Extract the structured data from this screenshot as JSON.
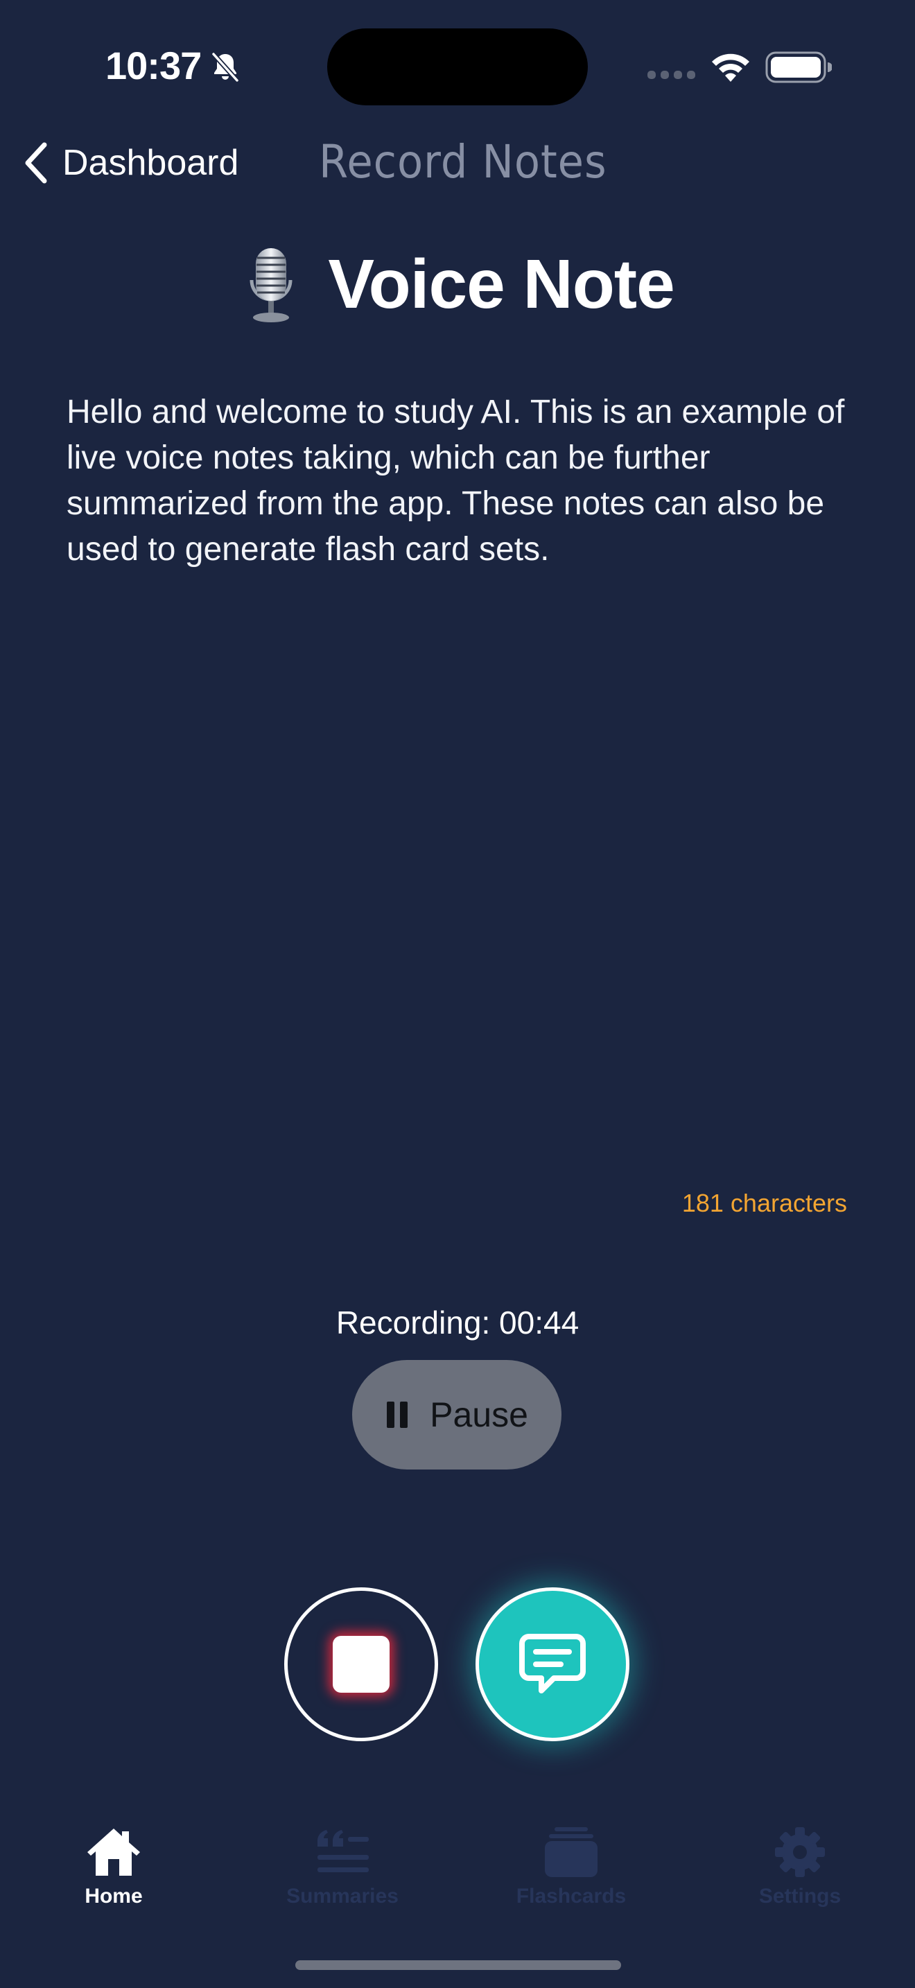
{
  "status_bar": {
    "time": "10:37"
  },
  "nav": {
    "back_label": "Dashboard",
    "title": "Record Notes"
  },
  "heading": {
    "text": "Voice Note"
  },
  "transcript": {
    "text": "Hello and welcome to study AI. This is an example of live voice notes taking, which can be further summarized from the app. These notes can also be used to generate flash card sets."
  },
  "char_count": "181 characters",
  "recording": {
    "label": "Recording: 00:44",
    "pause_label": "Pause"
  },
  "tabs": [
    {
      "label": "Home",
      "icon": "home-icon",
      "active": true
    },
    {
      "label": "Summaries",
      "icon": "quote-lines-icon",
      "active": false
    },
    {
      "label": "Flashcards",
      "icon": "cards-icon",
      "active": false
    },
    {
      "label": "Settings",
      "icon": "gear-icon",
      "active": false
    }
  ],
  "colors": {
    "background": "#1b2540",
    "accent_teal": "#1ec4bd",
    "char_count": "#f3a532",
    "pause_button": "#6b707c",
    "inactive_tab": "#27355a"
  }
}
